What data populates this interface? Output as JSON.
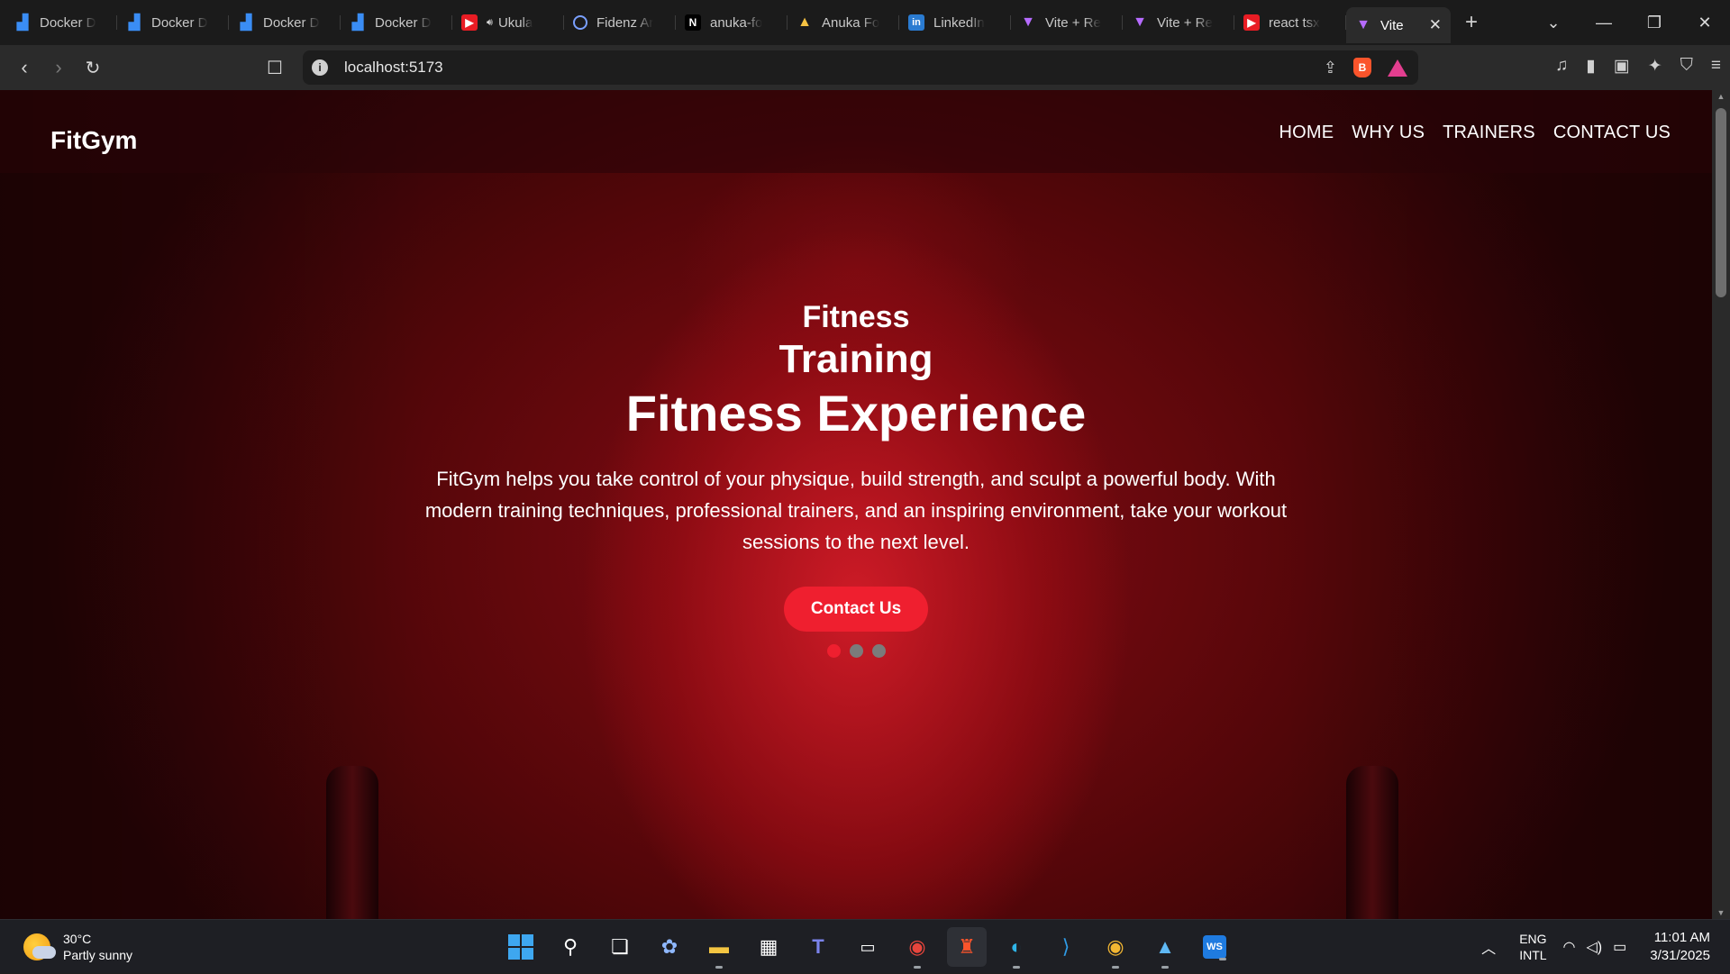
{
  "browser": {
    "tabs": [
      {
        "title": "Docker D",
        "icon": "docker-icon"
      },
      {
        "title": "Docker D",
        "icon": "docker-icon"
      },
      {
        "title": "Docker D",
        "icon": "docker-icon"
      },
      {
        "title": "Docker D",
        "icon": "docker-icon"
      },
      {
        "title": "Ukula",
        "icon": "youtube-icon"
      },
      {
        "title": "Fidenz Ar",
        "icon": "fidenz-icon"
      },
      {
        "title": "anuka-fo",
        "icon": "nextjs-icon"
      },
      {
        "title": "Anuka Fo",
        "icon": "google-drive-icon"
      },
      {
        "title": "LinkedIn",
        "icon": "linkedin-icon"
      },
      {
        "title": "Vite + Re",
        "icon": "vite-icon"
      },
      {
        "title": "Vite + Re",
        "icon": "vite-icon"
      },
      {
        "title": "react tsx",
        "icon": "youtube-icon"
      }
    ],
    "active_tab": {
      "title": "Vite",
      "icon": "vite-icon"
    },
    "url": "localhost:5173"
  },
  "site": {
    "logo": "FitGym",
    "nav": [
      "HOME",
      "WHY US",
      "TRAINERS",
      "CONTACT US"
    ],
    "hero": {
      "line1": "Fitness",
      "line2": "Training",
      "line3": "Fitness Experience",
      "description": "FitGym helps you take control of your physique, build strength, and sculpt a powerful body. With modern training techniques, professional trainers, and an inspiring environment, take your workout sessions to the next level.",
      "cta": "Contact Us",
      "slides_total": 3,
      "active_slide": 1
    },
    "colors": {
      "accent": "#ef1f2f",
      "hero_tint": "#8a0c14"
    }
  },
  "taskbar": {
    "weather": {
      "temp": "30°C",
      "condition": "Partly sunny"
    },
    "language": {
      "line1": "ENG",
      "line2": "INTL"
    },
    "clock": {
      "time": "11:01 AM",
      "date": "3/31/2025"
    }
  }
}
